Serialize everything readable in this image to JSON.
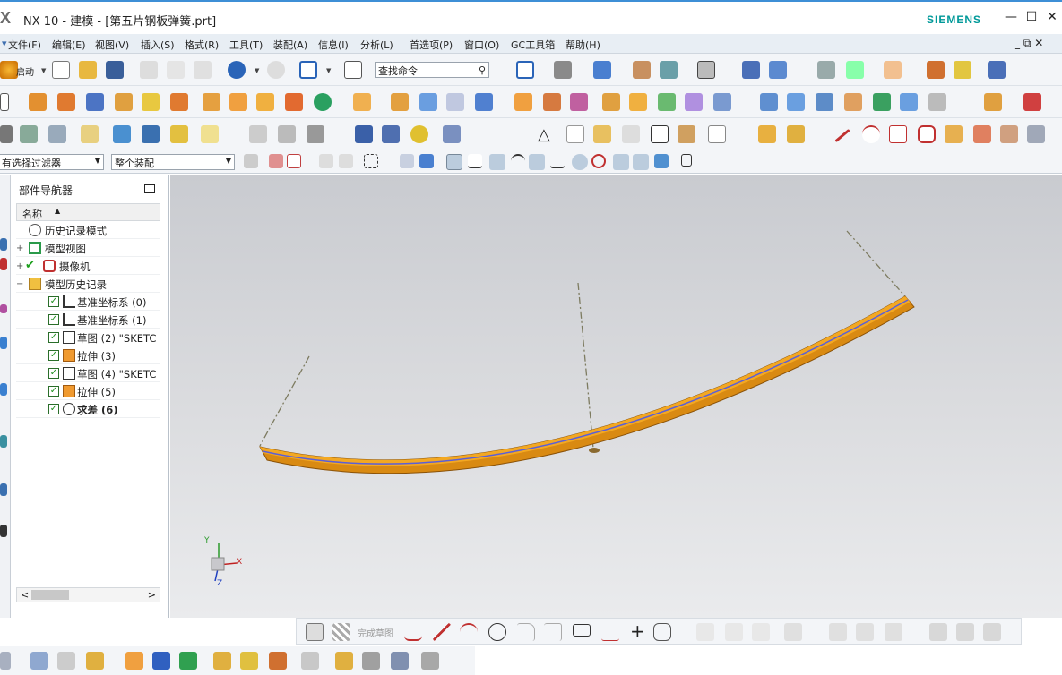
{
  "window": {
    "logo": "X",
    "title": "NX 10 - 建模 - [第五片钢板弹簧.prt]",
    "brand": "SIEMENS",
    "minimize": "—",
    "maximize": "☐",
    "close": "✕"
  },
  "menu": {
    "items": [
      "文件(F)",
      "编辑(E)",
      "视图(V)",
      "插入(S)",
      "格式(R)",
      "工具(T)",
      "装配(A)",
      "信息(I)",
      "分析(L)",
      "首选项(P)",
      "窗口(O)",
      "GC工具箱",
      "帮助(H)"
    ],
    "controls": "_ ⧉ ✕"
  },
  "toolbar": {
    "start_label": "启动",
    "search_placeholder": "查找命令"
  },
  "selection": {
    "filter_value": "有选择过滤器",
    "scope_value": "整个装配"
  },
  "navigator": {
    "title": "部件导航器",
    "column_name": "名称",
    "sort_arrow": "▲",
    "nodes": [
      {
        "label": "历史记录模式"
      },
      {
        "label": "模型视图"
      },
      {
        "label": "摄像机"
      },
      {
        "label": "模型历史记录"
      },
      {
        "label": "基准坐标系 (0)"
      },
      {
        "label": "基准坐标系 (1)"
      },
      {
        "label": "草图 (2) \"SKETC"
      },
      {
        "label": "拉伸 (3)"
      },
      {
        "label": "草图 (4) \"SKETC"
      },
      {
        "label": "拉伸 (5)"
      },
      {
        "label": "求差 (6)"
      }
    ],
    "scroll_left": "<",
    "scroll_right": ">"
  },
  "triad": {
    "x": "X",
    "y": "Y",
    "z": "Z"
  },
  "sketch_toolbar": {
    "finish_sketch": "完成草图"
  },
  "colors": {
    "accent": "#3d8fd6",
    "brand": "#009999",
    "spring_orange": "#f0a020",
    "viewport_top": "#c9cbd0"
  }
}
